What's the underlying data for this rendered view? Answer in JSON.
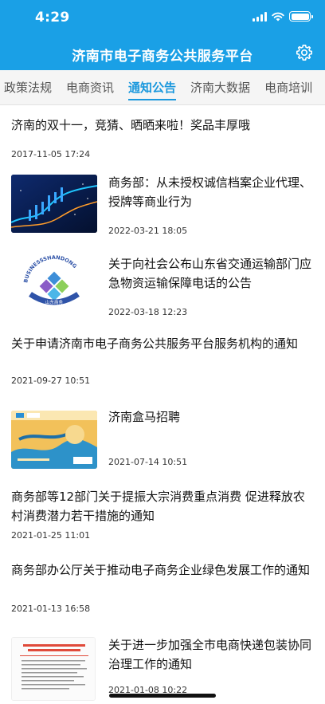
{
  "status": {
    "time": "4:29"
  },
  "header": {
    "title": "济南市电子商务公共服务平台"
  },
  "tabs": [
    {
      "label": "政策法规"
    },
    {
      "label": "电商资讯"
    },
    {
      "label": "通知公告"
    },
    {
      "label": "济南大数据"
    },
    {
      "label": "电商培训"
    }
  ],
  "active_tab": "通知公告",
  "news": [
    {
      "title": "济南的双十一，竞猜、晒晒来啦！奖品丰厚哦",
      "date": "2017-11-05 17:24"
    },
    {
      "title": "商务部：从未授权诚信档案企业代理、授牌等商业行为",
      "date": "2022-03-21 18:05",
      "thumb": "stock-chart-image"
    },
    {
      "title": "关于向社会公布山东省交通运输部门应急物资运输保障电话的公告",
      "date": "2022-03-18 12:23",
      "thumb": "shandong-commerce-logo",
      "logo_text": "BUSINESSSHANDONG",
      "logo_caption": "山东商务"
    },
    {
      "title": "关于申请济南市电子商务公共服务平台服务机构的通知",
      "date": "2021-09-27 10:51"
    },
    {
      "title": "济南盒马招聘",
      "date": "2021-07-14 10:51",
      "thumb": "hema-recruitment-poster"
    },
    {
      "title": "商务部等12部门关于提振大宗消费重点消费 促进释放农村消费潜力若干措施的通知",
      "date": "2021-01-25 11:01"
    },
    {
      "title": "商务部办公厅关于推动电子商务企业绿色发展工作的通知",
      "date": "2021-01-13 16:58"
    },
    {
      "title": "关于进一步加强全市电商快递包装协同治理工作的通知",
      "date": "2021-01-08 10:22",
      "thumb": "official-document-image"
    }
  ],
  "colors": {
    "header_bg": "#1aa0e6",
    "active_tab": "#1a98dd"
  }
}
